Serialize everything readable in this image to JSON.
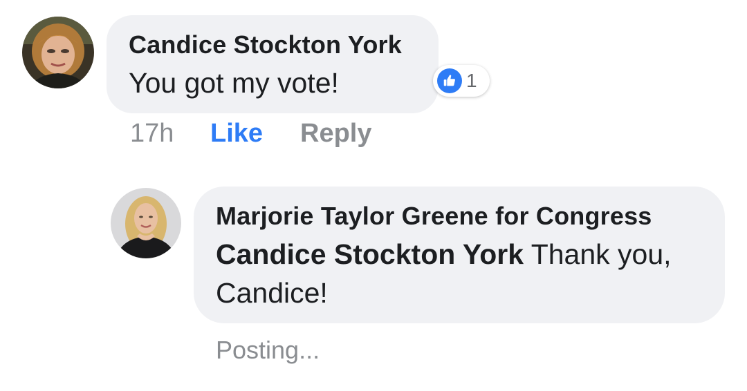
{
  "comment": {
    "author": "Candice Stockton York",
    "text": "You got my vote!",
    "reaction_count": "1",
    "time": "17h",
    "like_label": "Like",
    "reply_label": "Reply"
  },
  "reply": {
    "author": "Marjorie Taylor Greene for Congress",
    "tag": "Candice Stockton York",
    "text": "Thank you, Candice!",
    "status": "Posting..."
  },
  "colors": {
    "accent": "#2e7cf6",
    "bubble": "#f0f1f4",
    "muted": "#8a8d91"
  },
  "icons": {
    "reaction": "thumbs-up-icon"
  }
}
